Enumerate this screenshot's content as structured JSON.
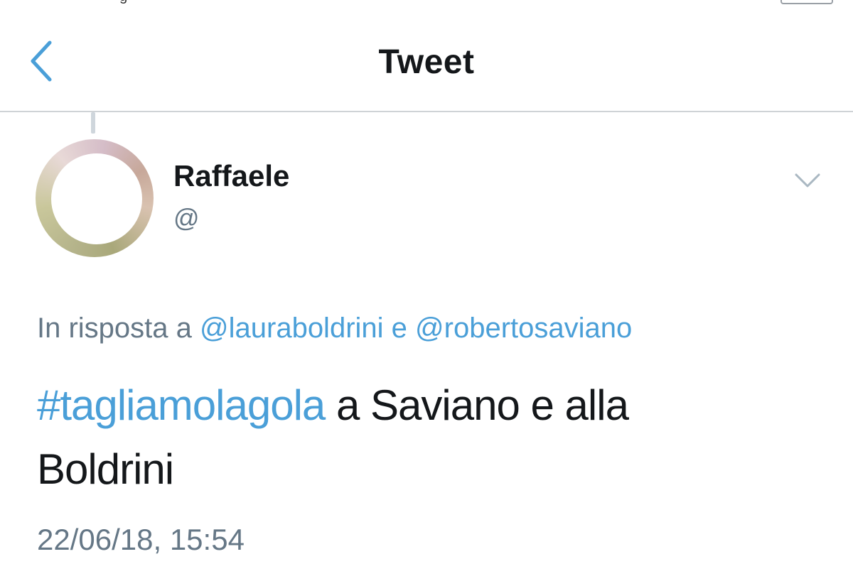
{
  "nav": {
    "title": "Tweet",
    "back_icon": "chevron-left-icon"
  },
  "tweet": {
    "author_name": "Raffaele",
    "author_handle": "@",
    "menu_icon": "chevron-down-icon",
    "reply_prefix": "In risposta a",
    "reply_mention_1": "@lauraboldrini",
    "reply_conjunction": "e",
    "reply_mention_2": "@robertosaviano",
    "hashtag": "#tagliamolagola",
    "text_rest_line1": "a Saviano e alla",
    "text_line2": "Boldrini",
    "timestamp": "22/06/18, 15:54"
  },
  "colors": {
    "link": "#4a9fd8",
    "muted": "#657786",
    "text": "#14171a"
  }
}
